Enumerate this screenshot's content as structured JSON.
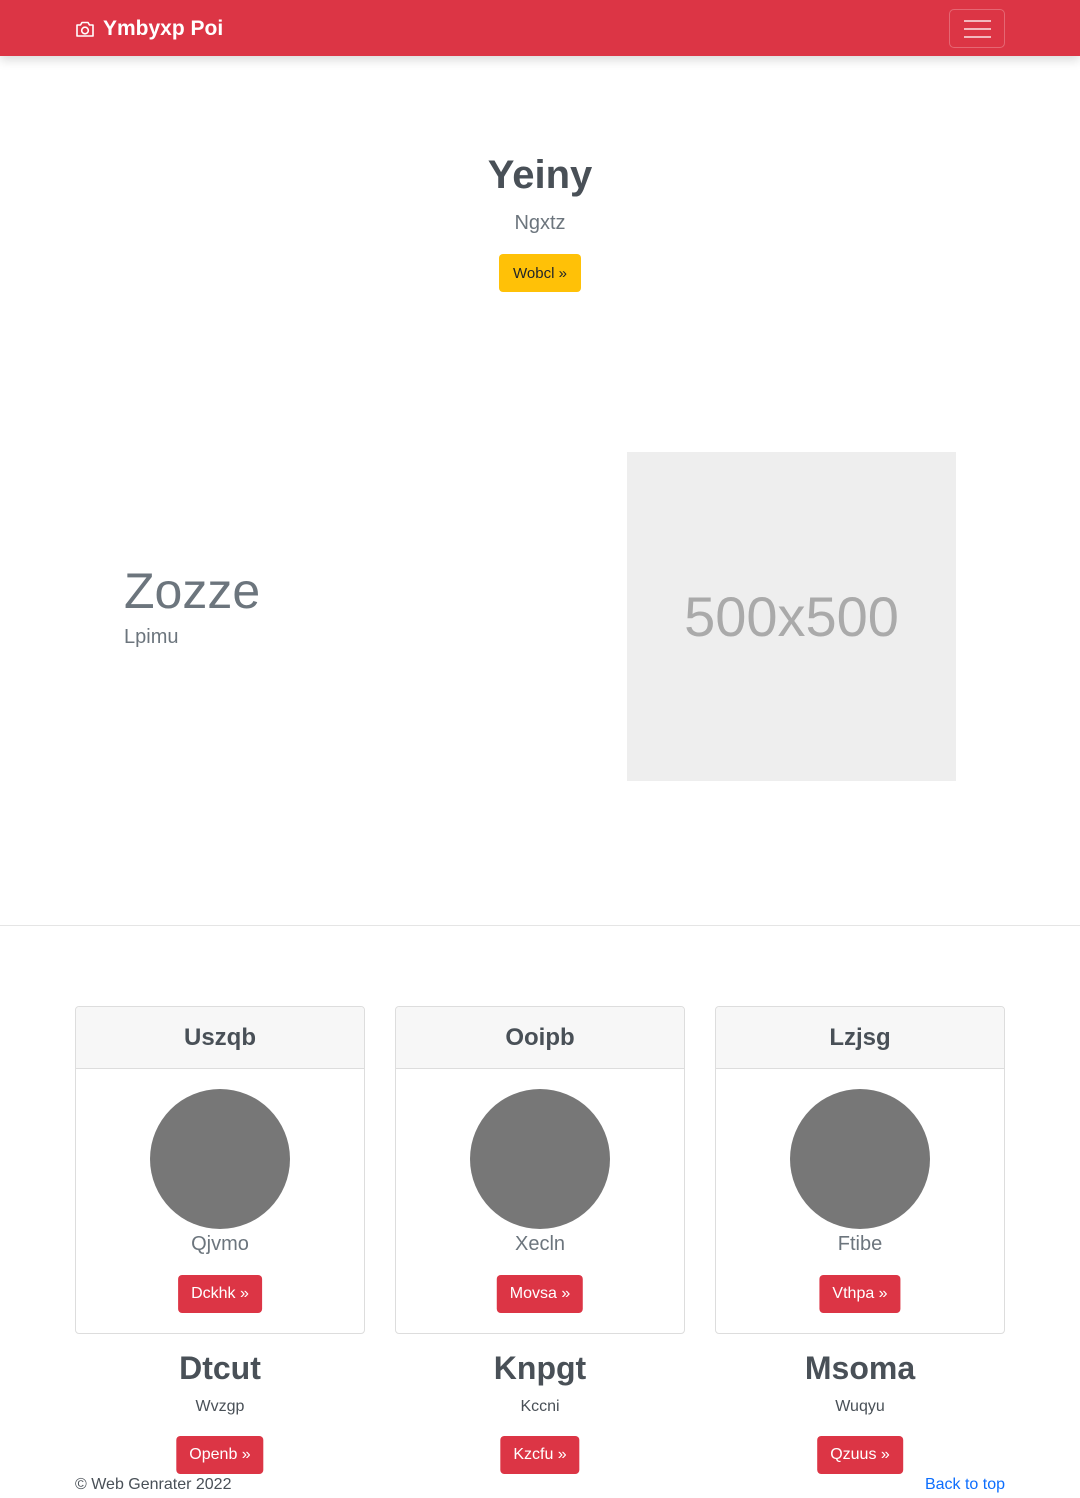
{
  "navbar": {
    "brand": "Ymbyxp Poi",
    "brand_icon": "camera-icon",
    "toggler_icon": "hamburger-menu-icon",
    "color": "#dc3545"
  },
  "hero": {
    "title": "Yeiny",
    "subtitle": "Ngxtz",
    "button": "Wobcl »",
    "button_color": "#ffc107"
  },
  "feature": {
    "title": "Zozze",
    "subtitle": "Lpimu",
    "image_text": "500x500"
  },
  "cards": [
    {
      "header": "Uszqb",
      "text": "Qjvmo",
      "button": "Dckhk »"
    },
    {
      "header": "Ooipb",
      "text": "Xecln",
      "button": "Movsa »"
    },
    {
      "header": "Lzjsg",
      "text": "Ftibe",
      "button": "Vthpa »"
    }
  ],
  "columns": [
    {
      "title": "Dtcut",
      "text": "Wvzgp",
      "button": "Openb »"
    },
    {
      "title": "Knpgt",
      "text": "Kccni",
      "button": "Kzcfu »"
    },
    {
      "title": "Msoma",
      "text": "Wuqyu",
      "button": "Qzuus »"
    }
  ],
  "footer": {
    "copyright": "© Web Genrater 2022",
    "back_to_top": "Back to top"
  }
}
